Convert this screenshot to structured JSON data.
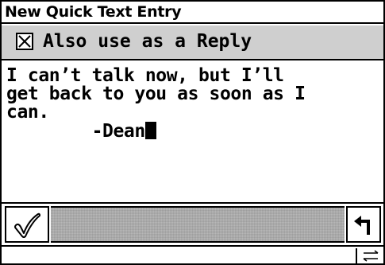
{
  "window": {
    "title": "New Quick Text Entry"
  },
  "reply_option": {
    "label": "Also use as a Reply",
    "checked": true
  },
  "message": {
    "lines": [
      "I can’t talk now, but I’ll",
      "get back to you as soon as I",
      "can.",
      "        -Dean"
    ]
  },
  "toolbar": {
    "ok_icon": "checkmark-icon",
    "return_icon": "return-arrow-icon"
  },
  "statusbar": {
    "swap_icon": "swap-arrows-icon"
  }
}
